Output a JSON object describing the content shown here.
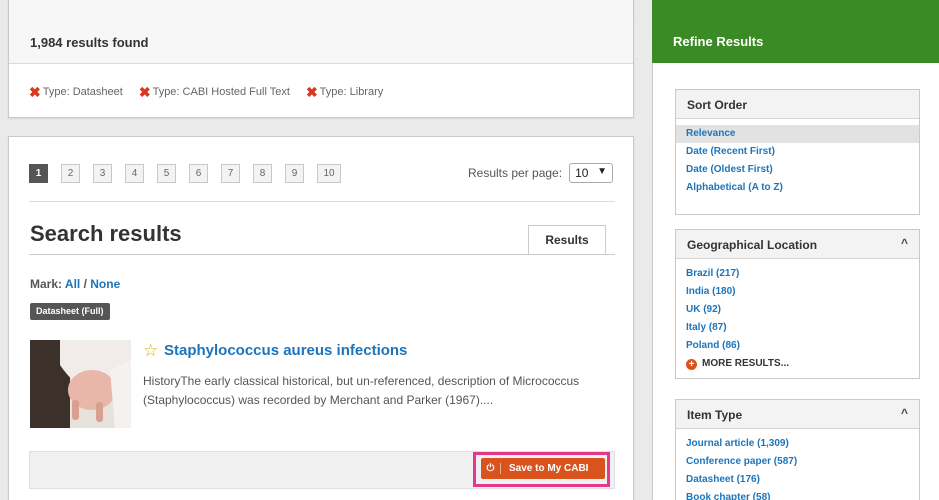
{
  "summary": {
    "count_text": "1,984 results found",
    "filters": [
      {
        "label": "Type: Datasheet"
      },
      {
        "label": "Type: CABI Hosted Full Text"
      },
      {
        "label": "Type: Library"
      }
    ]
  },
  "pagination": {
    "pages": [
      "1",
      "2",
      "3",
      "4",
      "5",
      "6",
      "7",
      "8",
      "9",
      "10"
    ],
    "current": "1",
    "rpp_label": "Results per page:",
    "rpp_value": "10"
  },
  "results": {
    "heading": "Search results",
    "tab_label": "Results",
    "mark_label": "Mark:",
    "mark_all": "All",
    "mark_sep": " / ",
    "mark_none": "None",
    "items": [
      {
        "badge": "Datasheet (Full)",
        "title": "Staphylococcus aureus infections",
        "description": "HistoryThe early classical historical, but un-referenced, description of Micrococcus (Staphylococcus) was recorded by Merchant and Parker (1967)....",
        "save_label": "Save to My CABI"
      }
    ]
  },
  "sidebar": {
    "header": "Refine Results",
    "sort": {
      "title": "Sort Order",
      "options": [
        "Relevance",
        "Date (Recent First)",
        "Date (Oldest First)",
        "Alphabetical (A to Z)"
      ],
      "selected": "Relevance"
    },
    "geo": {
      "title": "Geographical Location",
      "items": [
        "Brazil (217)",
        "India (180)",
        "UK (92)",
        "Italy (87)",
        "Poland (86)"
      ],
      "more_label": "MORE RESULTS..."
    },
    "item_type": {
      "title": "Item Type",
      "items": [
        "Journal article (1,309)",
        "Conference paper (587)",
        "Datasheet (176)",
        "Book chapter (58)"
      ]
    }
  },
  "colors": {
    "accent_green": "#3a8a25",
    "link_blue": "#1c75bc",
    "save_orange": "#d9531e",
    "highlight_pink": "#e4388d",
    "filter_x_red": "#d9371f"
  }
}
